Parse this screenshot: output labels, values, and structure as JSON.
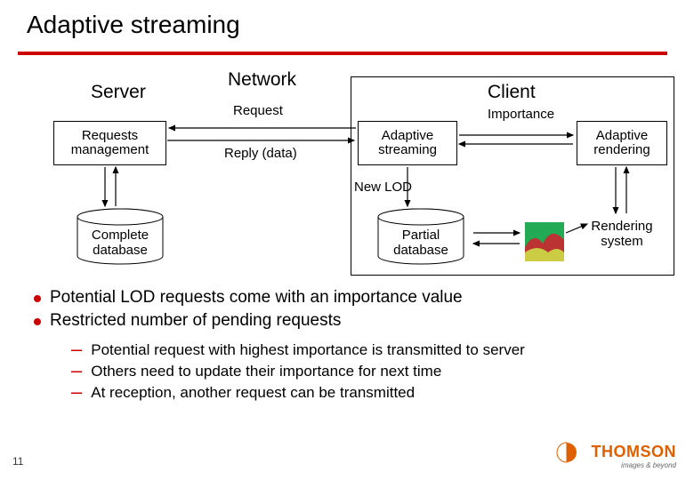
{
  "title": "Adaptive streaming",
  "sections": {
    "server": "Server",
    "network": "Network",
    "client": "Client"
  },
  "boxes": {
    "requests_mgmt": "Requests\nmanagement",
    "adaptive_streaming": "Adaptive\nstreaming",
    "adaptive_rendering": "Adaptive\nrendering",
    "complete_db": "Complete\ndatabase",
    "partial_db": "Partial\ndatabase",
    "rendering_sys": "Rendering\nsystem"
  },
  "arrows": {
    "request": "Request",
    "reply": "Reply (data)",
    "importance": "Importance",
    "new_lod": "New LOD"
  },
  "bullets": [
    "Potential LOD requests come with an importance value",
    "Restricted number of pending requests"
  ],
  "subbullets": [
    "Potential request with highest importance is transmitted to server",
    "Others need to update their importance for next time",
    "At reception, another request can be transmitted"
  ],
  "page_number": "11",
  "logo": {
    "brand": "THOMSON",
    "tagline": "images & beyond"
  }
}
